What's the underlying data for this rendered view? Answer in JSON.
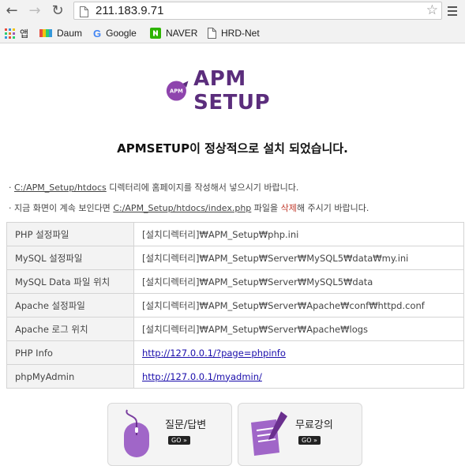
{
  "browser": {
    "url": "211.183.9.71",
    "bookmarks": [
      {
        "label": "앱",
        "icon": "apps-icon"
      },
      {
        "label": "Daum",
        "icon": "daum-icon"
      },
      {
        "label": "Google",
        "icon": "google-icon"
      },
      {
        "label": "NAVER",
        "icon": "naver-icon"
      },
      {
        "label": "HRD-Net",
        "icon": "page-icon"
      }
    ]
  },
  "page": {
    "logo_text": "APM SETUP",
    "logo_badge": "APM",
    "headline": "APMSETUP이 정상적으로 설치 되었습니다.",
    "note1": {
      "bullet": "·",
      "link": "C:/APM_Setup/htdocs",
      "text": " 디렉터리에 홈페이지를 작성해서 넣으시기 바랍니다."
    },
    "note2": {
      "bullet": "·",
      "pre": " 지금 화면이 계속 보인다면 ",
      "link": "C:/APM_Setup/htdocs/index.php",
      "mid": " 파일을 ",
      "red": "삭제",
      "post": "해 주시기 바랍니다."
    },
    "rows": [
      {
        "key": "PHP 설정파일",
        "value": "[설치디렉터리]₩APM_Setup₩php.ini"
      },
      {
        "key": "MySQL 설정파일",
        "value": "[설치디렉터리]₩APM_Setup₩Server₩MySQL5₩data₩my.ini"
      },
      {
        "key": "MySQL Data 파일 위치",
        "value": "[설치디렉터리]₩APM_Setup₩Server₩MySQL5₩data"
      },
      {
        "key": "Apache 설정파일",
        "value": "[설치디렉터리]₩APM_Setup₩Server₩Apache₩conf₩httpd.conf"
      },
      {
        "key": "Apache 로그 위치",
        "value": "[설치디렉터리]₩APM_Setup₩Server₩Apache₩logs"
      },
      {
        "key": "PHP Info",
        "value": "http://127.0.0.1/?page=phpinfo"
      },
      {
        "key": "phpMyAdmin",
        "value": "http://127.0.0.1/myadmin/"
      }
    ],
    "tiles": [
      {
        "label": "질문/답변",
        "go": "GO »"
      },
      {
        "label": "무료강의",
        "go": "GO »"
      }
    ]
  }
}
